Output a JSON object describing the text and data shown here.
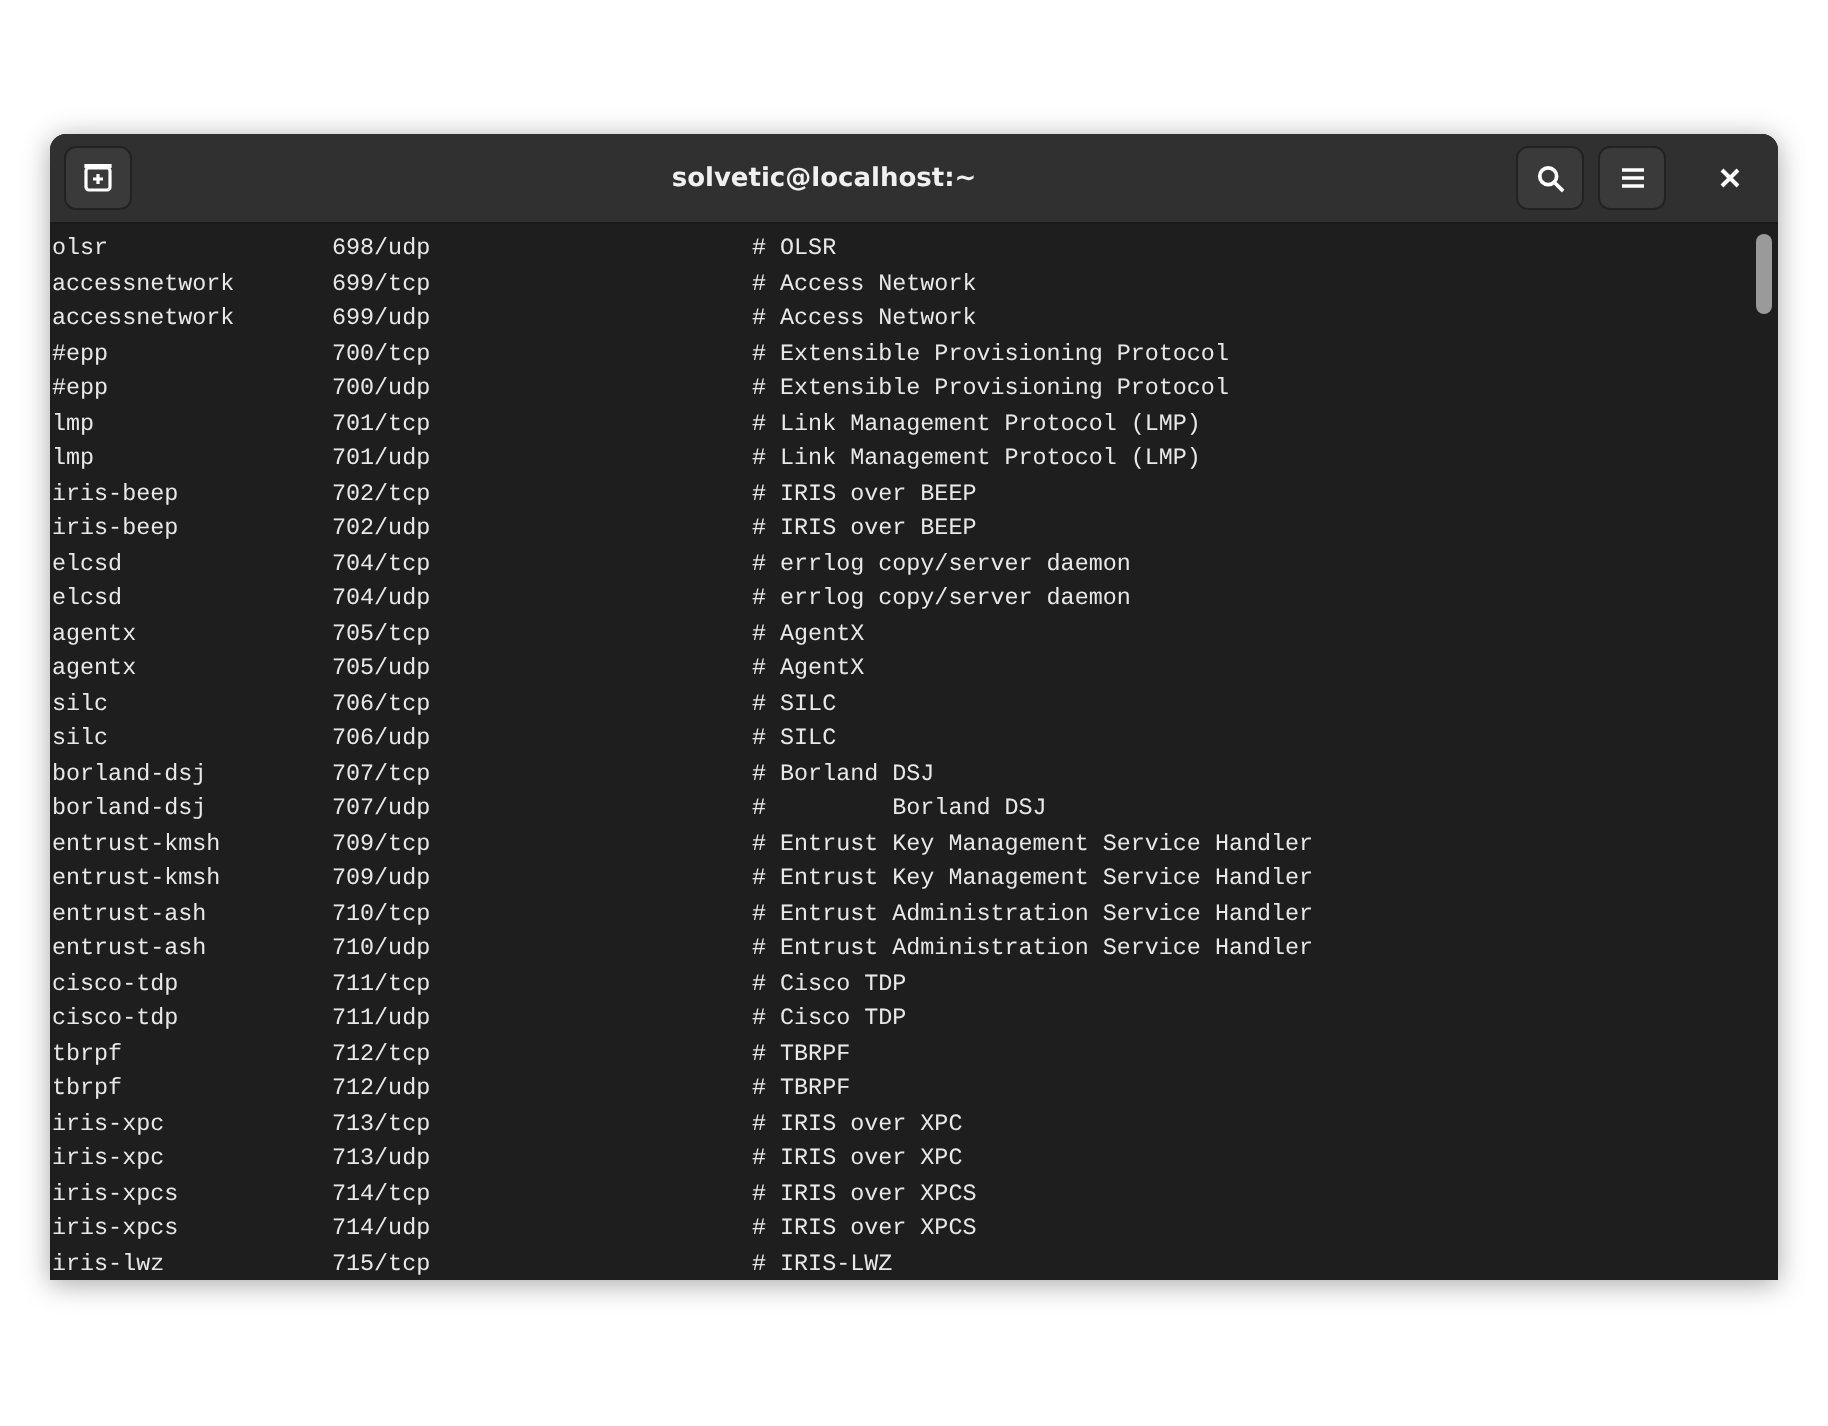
{
  "window": {
    "title": "solvetic@localhost:~"
  },
  "terminal": {
    "rows": [
      {
        "service": "olsr",
        "port": "698/udp",
        "comment": "# OLSR"
      },
      {
        "service": "accessnetwork",
        "port": "699/tcp",
        "comment": "# Access Network"
      },
      {
        "service": "accessnetwork",
        "port": "699/udp",
        "comment": "# Access Network"
      },
      {
        "service": "#epp",
        "port": "700/tcp",
        "comment": "# Extensible Provisioning Protocol"
      },
      {
        "service": "#epp",
        "port": "700/udp",
        "comment": "# Extensible Provisioning Protocol"
      },
      {
        "service": "lmp",
        "port": "701/tcp",
        "comment": "# Link Management Protocol (LMP)"
      },
      {
        "service": "lmp",
        "port": "701/udp",
        "comment": "# Link Management Protocol (LMP)"
      },
      {
        "service": "iris-beep",
        "port": "702/tcp",
        "comment": "# IRIS over BEEP"
      },
      {
        "service": "iris-beep",
        "port": "702/udp",
        "comment": "# IRIS over BEEP"
      },
      {
        "service": "elcsd",
        "port": "704/tcp",
        "comment": "# errlog copy/server daemon"
      },
      {
        "service": "elcsd",
        "port": "704/udp",
        "comment": "# errlog copy/server daemon"
      },
      {
        "service": "agentx",
        "port": "705/tcp",
        "comment": "# AgentX"
      },
      {
        "service": "agentx",
        "port": "705/udp",
        "comment": "# AgentX"
      },
      {
        "service": "silc",
        "port": "706/tcp",
        "comment": "# SILC"
      },
      {
        "service": "silc",
        "port": "706/udp",
        "comment": "# SILC"
      },
      {
        "service": "borland-dsj",
        "port": "707/tcp",
        "comment": "# Borland DSJ"
      },
      {
        "service": "borland-dsj",
        "port": "707/udp",
        "comment": "#         Borland DSJ"
      },
      {
        "service": "entrust-kmsh",
        "port": "709/tcp",
        "comment": "# Entrust Key Management Service Handler"
      },
      {
        "service": "entrust-kmsh",
        "port": "709/udp",
        "comment": "# Entrust Key Management Service Handler"
      },
      {
        "service": "entrust-ash",
        "port": "710/tcp",
        "comment": "# Entrust Administration Service Handler"
      },
      {
        "service": "entrust-ash",
        "port": "710/udp",
        "comment": "# Entrust Administration Service Handler"
      },
      {
        "service": "cisco-tdp",
        "port": "711/tcp",
        "comment": "# Cisco TDP"
      },
      {
        "service": "cisco-tdp",
        "port": "711/udp",
        "comment": "# Cisco TDP"
      },
      {
        "service": "tbrpf",
        "port": "712/tcp",
        "comment": "# TBRPF"
      },
      {
        "service": "tbrpf",
        "port": "712/udp",
        "comment": "# TBRPF"
      },
      {
        "service": "iris-xpc",
        "port": "713/tcp",
        "comment": "# IRIS over XPC"
      },
      {
        "service": "iris-xpc",
        "port": "713/udp",
        "comment": "# IRIS over XPC"
      },
      {
        "service": "iris-xpcs",
        "port": "714/tcp",
        "comment": "# IRIS over XPCS"
      },
      {
        "service": "iris-xpcs",
        "port": "714/udp",
        "comment": "# IRIS over XPCS"
      },
      {
        "service": "iris-lwz",
        "port": "715/tcp",
        "comment": "# IRIS-LWZ"
      }
    ]
  }
}
